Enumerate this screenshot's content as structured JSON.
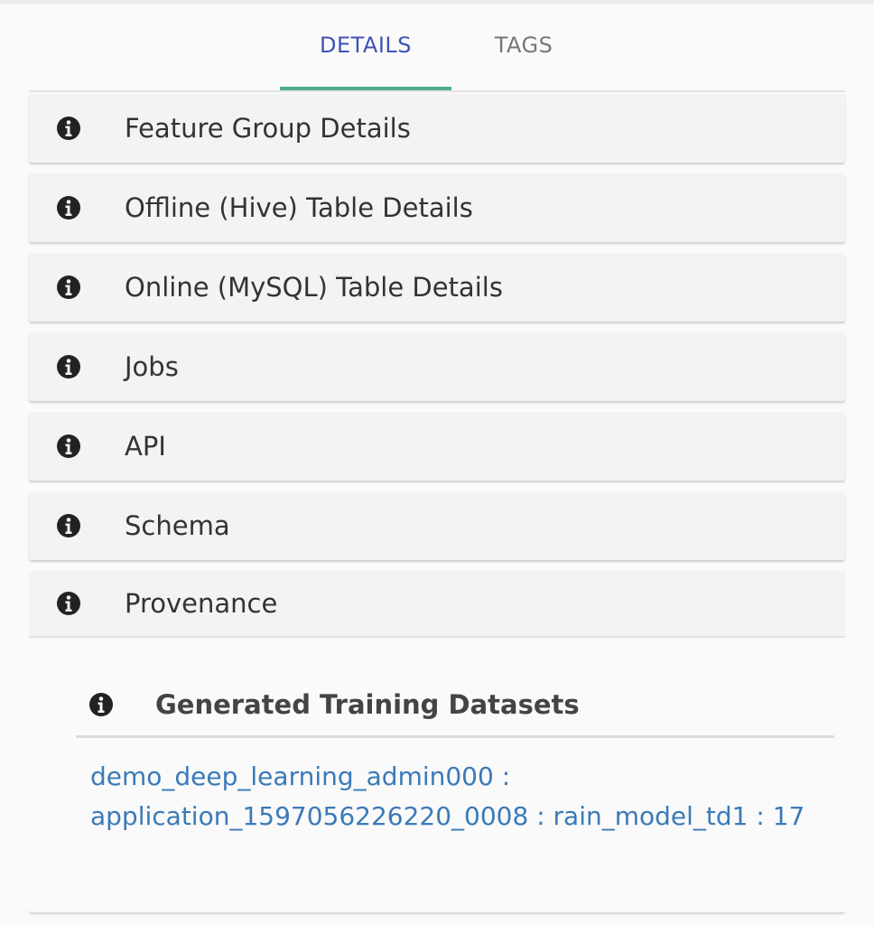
{
  "tabs": [
    {
      "label": "DETAILS",
      "active": true
    },
    {
      "label": "TAGS",
      "active": false
    }
  ],
  "panels": [
    {
      "icon": "info-icon",
      "label": "Feature Group Details"
    },
    {
      "icon": "info-icon",
      "label": "Offline (Hive) Table Details"
    },
    {
      "icon": "info-icon",
      "label": "Online (MySQL) Table Details"
    },
    {
      "icon": "info-icon",
      "label": "Jobs"
    },
    {
      "icon": "info-icon",
      "label": "API"
    },
    {
      "icon": "info-icon",
      "label": "Schema"
    },
    {
      "icon": "info-icon",
      "label": "Provenance",
      "expanded": true
    }
  ],
  "provenance": {
    "section_title": "Generated Training Datasets",
    "section_icon": "info-icon",
    "dataset_line1": "demo_deep_learning_admin000 :",
    "dataset_line2": "application_1597056226220_0008 : rain_model_td1 : 17"
  },
  "colors": {
    "active_tab": "#3f51b5",
    "tab_indicator": "#4fae88",
    "link": "#3a7ab8",
    "panel_bg": "#f3f3f3"
  }
}
